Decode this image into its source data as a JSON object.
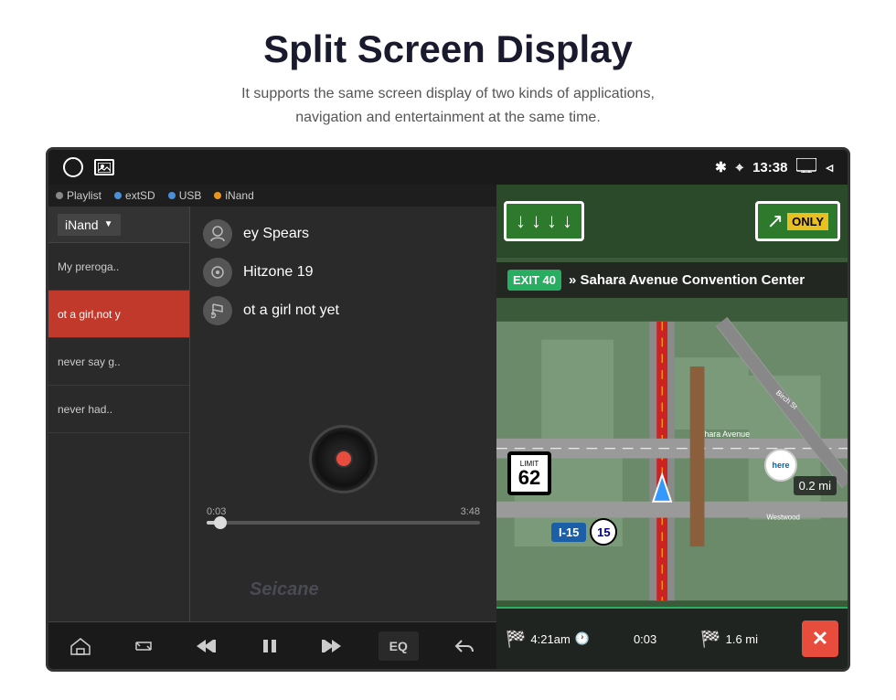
{
  "header": {
    "title": "Split Screen Display",
    "subtitle_line1": "It supports the same screen display of two kinds of applications,",
    "subtitle_line2": "navigation and entertainment at the same time."
  },
  "status_bar": {
    "time": "13:38",
    "bluetooth_icon": "bluetooth",
    "location_icon": "location-pin",
    "screen_icon": "screen",
    "back_icon": "back-arrow"
  },
  "music_player": {
    "storage_label": "iNand",
    "tabs": [
      {
        "label": "Playlist",
        "dot_color": "gray"
      },
      {
        "label": "extSD",
        "dot_color": "blue"
      },
      {
        "label": "USB",
        "dot_color": "blue"
      },
      {
        "label": "iNand",
        "dot_color": "orange"
      }
    ],
    "playlist": [
      {
        "title": "My preroga..",
        "active": false
      },
      {
        "title": "ot a girl,not y",
        "active": true,
        "color": "red"
      },
      {
        "title": "never say g..",
        "active": false
      },
      {
        "title": "never had..",
        "active": false
      }
    ],
    "artist": "ey Spears",
    "album": "Hitzone 19",
    "track": "ot a girl not yet",
    "current_time": "0:03",
    "total_time": "3:48",
    "progress_percent": 5,
    "transport": {
      "home": "⌂",
      "repeat": "↻",
      "prev": "⏮",
      "play_pause": "⏸",
      "next": "⏭",
      "eq": "EQ",
      "back": "↩"
    },
    "watermark": "Seicane"
  },
  "navigation": {
    "highway_label": "I-15",
    "exit_number": "EXIT 40",
    "destination_line1": "» Sahara Avenue",
    "destination_line2": "Convention Center",
    "road_labels": [
      "Sahara Avenue",
      "Birch St",
      "Westwood"
    ],
    "only_label": "ONLY",
    "speed_limit": "62",
    "route_id": "I-15",
    "route_number": "15",
    "distance_display": "0.2 mi",
    "here_logo": "here",
    "bottom_bar": {
      "eta": "4:21am",
      "elapsed": "0:03",
      "remaining": "1.6 mi"
    },
    "close_label": "✕"
  }
}
